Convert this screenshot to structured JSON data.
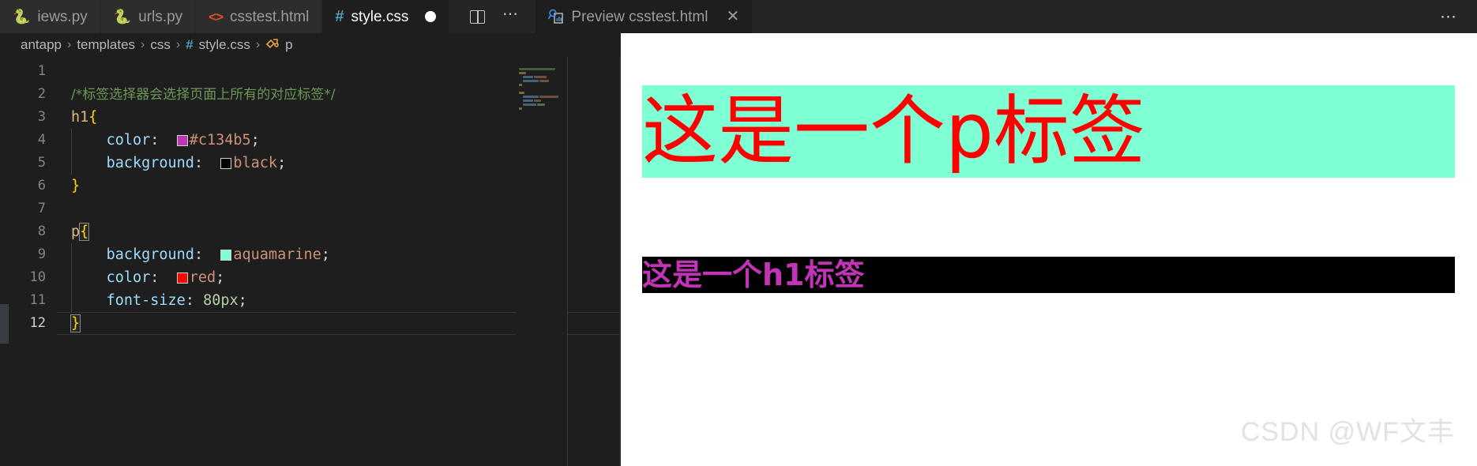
{
  "tabs": [
    {
      "label": "iews.py",
      "icon": "python-icon",
      "icon_glyph": "🐍",
      "active": false,
      "dirty": false,
      "truncated": true
    },
    {
      "label": "urls.py",
      "icon": "python-icon",
      "icon_glyph": "🐍",
      "active": false,
      "dirty": false
    },
    {
      "label": "csstest.html",
      "icon": "html-icon",
      "icon_glyph": "<>",
      "active": false,
      "dirty": false
    },
    {
      "label": "style.css",
      "icon": "css-hash-icon",
      "icon_glyph": "#",
      "active": true,
      "dirty": true
    }
  ],
  "tab_actions": {
    "split_editor": "split-editor-icon",
    "more_actions": "more-actions-icon",
    "more_actions_glyph": "⋯"
  },
  "preview_tab": {
    "label": "Preview csstest.html",
    "icon": "preview-icon",
    "close_glyph": "✕"
  },
  "window_actions": {
    "more_glyph": "⋯"
  },
  "breadcrumb": {
    "separator": "›",
    "items": [
      {
        "label": "antapp",
        "icon": null
      },
      {
        "label": "templates",
        "icon": null
      },
      {
        "label": "css",
        "icon": null
      },
      {
        "label": "style.css",
        "icon": "css-hash-icon",
        "icon_glyph": "#"
      },
      {
        "label": "p",
        "icon": "css-selector-icon",
        "icon_glyph": "❈"
      }
    ]
  },
  "editor": {
    "language": "css",
    "file": "style.css",
    "current_line": 12,
    "line_numbers": [
      "1",
      "2",
      "3",
      "4",
      "5",
      "6",
      "7",
      "8",
      "9",
      "10",
      "11",
      "12"
    ],
    "lines": [
      {
        "n": 1,
        "text": ""
      },
      {
        "n": 2,
        "text": "/*标签选择器会选择页面上所有的对应标签*/"
      },
      {
        "n": 3,
        "text": "h1{"
      },
      {
        "n": 4,
        "text": "    color:  #c134b5;"
      },
      {
        "n": 5,
        "text": "    background:  black;"
      },
      {
        "n": 6,
        "text": "}"
      },
      {
        "n": 7,
        "text": ""
      },
      {
        "n": 8,
        "text": "p{"
      },
      {
        "n": 9,
        "text": "    background:  aquamarine;"
      },
      {
        "n": 10,
        "text": "    color:  red;"
      },
      {
        "n": 11,
        "text": "    font-size: 80px;"
      },
      {
        "n": 12,
        "text": "}"
      }
    ],
    "tokens": {
      "comment": "/*标签选择器会选择页面上所有的对应标签*/",
      "sel_h1": "h1",
      "sel_p": "p",
      "brace_open": "{",
      "brace_close": "}",
      "prop_color": "color",
      "prop_background": "background",
      "prop_font_size": "font-size",
      "colon": ":",
      "semicolon": ";",
      "val_hex": "#c134b5",
      "val_black": "black",
      "val_aquamarine": "aquamarine",
      "val_red": "red",
      "val_fontsize": "80px"
    },
    "swatches": {
      "hex": "#c134b5",
      "black": "#000000",
      "aquamarine": "#7fffd4",
      "red": "#ff0000"
    }
  },
  "preview": {
    "p_text": "这是一个p标签",
    "p_color": "#ff0000",
    "p_background": "#7fffd4",
    "p_font_size": "80px",
    "h1_text": "这是一个h1标签",
    "h1_color": "#c134b5",
    "h1_background": "#000000"
  },
  "watermark": "CSDN @WF文丰",
  "theme": {
    "editor_bg": "#1e1e1e",
    "tabbar_bg": "#252526",
    "inactive_tab_bg": "#2d2d2d",
    "comment_green": "#6a9955",
    "selector_gold": "#d7ba7d",
    "brace_yellow": "#ffd700",
    "property_blue": "#9cdcfe",
    "value_orange": "#ce9178",
    "number_green": "#b5cea8",
    "preview_bg": "#ffffff"
  }
}
